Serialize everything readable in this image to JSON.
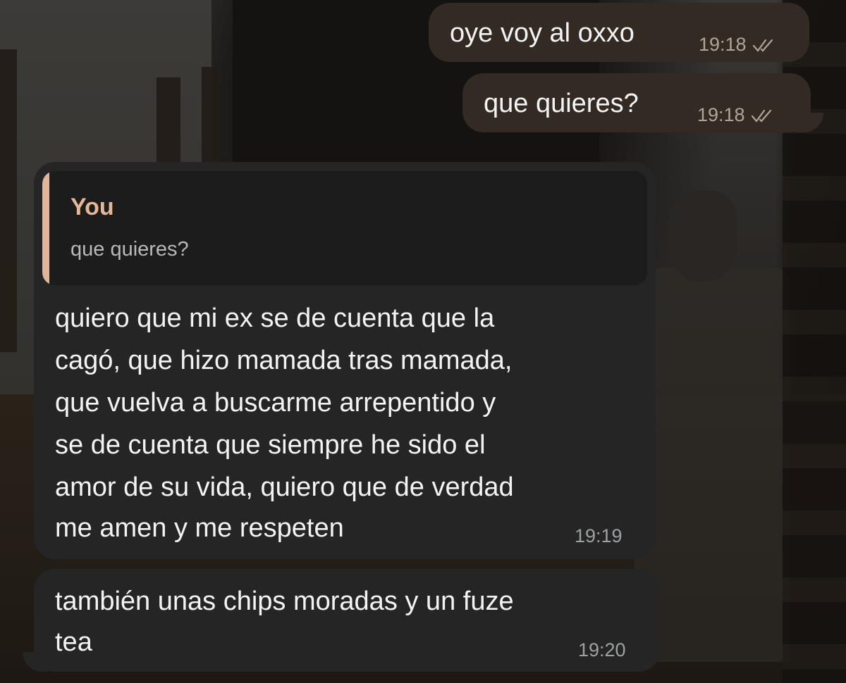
{
  "messages": [
    {
      "direction": "outgoing",
      "text": "oye voy al oxxo",
      "time": "19:18",
      "status": "read-double-check"
    },
    {
      "direction": "outgoing",
      "text": "que quieres?",
      "time": "19:18",
      "status": "read-double-check"
    },
    {
      "direction": "incoming",
      "reply_to": {
        "author": "You",
        "text": "que quieres?"
      },
      "text_lines": [
        "quiero que mi ex se de cuenta que la",
        "cagó, que hizo mamada tras mamada,",
        "que vuelva a buscarme arrepentido y",
        "se de cuenta que siempre he sido el",
        "amor de su vida, quiero que de verdad",
        "me amen y me respeten"
      ],
      "time": "19:19"
    },
    {
      "direction": "incoming",
      "text_lines": [
        "también unas chips moradas y un fuze",
        "tea"
      ],
      "time": "19:20"
    }
  ],
  "colors": {
    "outgoing_bubble": "#332a24",
    "incoming_bubble": "#252525",
    "reply_accent": "#dfb697",
    "text": "#f3f3f3"
  },
  "icons": {
    "read_status": "double-check-icon"
  }
}
